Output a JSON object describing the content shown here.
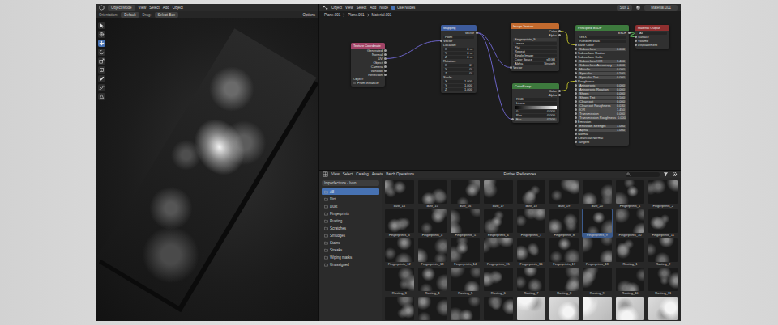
{
  "viewport": {
    "mode": "Object Mode",
    "menus": [
      "View",
      "Select",
      "Add",
      "Object"
    ],
    "orientation_label": "Orientation:",
    "orientation": "Default",
    "drag_label": "Drag:",
    "drag": "Select Box",
    "options": "Options",
    "tools": [
      {
        "kind": "select",
        "selected": false
      },
      {
        "kind": "cursor",
        "selected": false
      },
      {
        "kind": "move",
        "selected": true
      },
      {
        "kind": "rotate",
        "selected": false
      },
      {
        "kind": "scale",
        "selected": false
      },
      {
        "kind": "transform",
        "selected": false
      },
      {
        "kind": "annotate",
        "selected": false
      },
      {
        "kind": "measure",
        "selected": false
      },
      {
        "kind": "add",
        "selected": false
      }
    ]
  },
  "node_editor": {
    "menus": [
      "Object",
      "View",
      "Select",
      "Add",
      "Node"
    ],
    "use_nodes": "Use Nodes",
    "use_nodes_on": true,
    "slot": "Slot 1",
    "material": "Material.001",
    "breadcrumbs": [
      "Plane.001",
      "Plane.001",
      "Material.001"
    ]
  },
  "nodes": [
    {
      "title": "Texture Coordinate",
      "color": "#a14467",
      "rows": [
        {
          "label": "Generated",
          "kind": "out"
        },
        {
          "label": "Normal",
          "kind": "out"
        },
        {
          "label": "UV",
          "kind": "out"
        },
        {
          "label": "Object",
          "kind": "out"
        },
        {
          "label": "Camera",
          "kind": "out"
        },
        {
          "label": "Window",
          "kind": "out"
        },
        {
          "label": "Reflection",
          "kind": "out"
        },
        {
          "label": "Object:",
          "kind": "label"
        },
        {
          "label": "From Instancer",
          "kind": "check",
          "checked": false
        }
      ]
    },
    {
      "title": "Mapping",
      "color": "#3d5b9c",
      "rows": [
        {
          "label": "Vector",
          "kind": "out"
        },
        {
          "label": "Point",
          "kind": "field"
        },
        {
          "label": "Vector",
          "kind": "in"
        },
        {
          "label": "Location:",
          "kind": "label"
        },
        {
          "label": "X",
          "value": "0 m",
          "kind": "field"
        },
        {
          "label": "Y",
          "value": "0 m",
          "kind": "field"
        },
        {
          "label": "Z",
          "value": "0 m",
          "kind": "field"
        },
        {
          "label": "Rotation:",
          "kind": "label"
        },
        {
          "label": "X",
          "value": "0°",
          "kind": "field"
        },
        {
          "label": "Y",
          "value": "0°",
          "kind": "field"
        },
        {
          "label": "Z",
          "value": "0°",
          "kind": "field"
        },
        {
          "label": "Scale:",
          "kind": "label"
        },
        {
          "label": "X",
          "value": "1.000",
          "kind": "field"
        },
        {
          "label": "Y",
          "value": "1.000",
          "kind": "field"
        },
        {
          "label": "Z",
          "value": "1.000",
          "kind": "field"
        }
      ]
    },
    {
      "title": "Image Texture",
      "color": "#c26a2e",
      "rows": [
        {
          "label": "Color",
          "kind": "out"
        },
        {
          "label": "Alpha",
          "kind": "out"
        },
        {
          "label": "Fingerprints_9",
          "kind": "image"
        },
        {
          "label": "Linear",
          "kind": "field"
        },
        {
          "label": "Flat",
          "kind": "field"
        },
        {
          "label": "Repeat",
          "kind": "field"
        },
        {
          "label": "Single Image",
          "kind": "field"
        },
        {
          "label": "Color Space",
          "value": "sRGB",
          "kind": "field"
        },
        {
          "label": "Alpha",
          "value": "Straight",
          "kind": "field"
        },
        {
          "label": "Vector",
          "kind": "in"
        }
      ]
    },
    {
      "title": "ColorRamp",
      "color": "#3d7a3d",
      "rows": [
        {
          "label": "Color",
          "kind": "out"
        },
        {
          "label": "Alpha",
          "kind": "out"
        },
        {
          "label": "RGB",
          "kind": "field"
        },
        {
          "label": "Linear",
          "kind": "field"
        },
        {
          "kind": "ramp"
        },
        {
          "label": "0",
          "value": "0.000",
          "kind": "field"
        },
        {
          "label": "Pos",
          "value": "0.000",
          "kind": "field"
        },
        {
          "label": "Fac",
          "value": "0.500",
          "kind": "in"
        }
      ]
    },
    {
      "title": "Principled BSDF",
      "color": "#3d7a3d",
      "rows": [
        {
          "label": "BSDF",
          "kind": "out"
        },
        {
          "label": "GGX",
          "kind": "field"
        },
        {
          "label": "Random Walk",
          "kind": "field"
        },
        {
          "label": "Base Color",
          "kind": "in"
        },
        {
          "label": "Subsurface",
          "value": "0.000",
          "kind": "in"
        },
        {
          "label": "Subsurface Radius",
          "kind": "in"
        },
        {
          "label": "Subsurface Color",
          "kind": "in"
        },
        {
          "label": "Subsurface IOR",
          "value": "1.400",
          "kind": "in"
        },
        {
          "label": "Subsurface Anisotropy",
          "value": "0.000",
          "kind": "in"
        },
        {
          "label": "Metallic",
          "value": "0.000",
          "kind": "in"
        },
        {
          "label": "Specular",
          "value": "0.500",
          "kind": "in"
        },
        {
          "label": "Specular Tint",
          "value": "0.000",
          "kind": "in"
        },
        {
          "label": "Roughness",
          "kind": "in"
        },
        {
          "label": "Anisotropic",
          "value": "0.000",
          "kind": "in"
        },
        {
          "label": "Anisotropic Rotation",
          "value": "0.000",
          "kind": "in"
        },
        {
          "label": "Sheen",
          "value": "0.000",
          "kind": "in"
        },
        {
          "label": "Sheen Tint",
          "value": "0.500",
          "kind": "in"
        },
        {
          "label": "Clearcoat",
          "value": "0.000",
          "kind": "in"
        },
        {
          "label": "Clearcoat Roughness",
          "value": "0.030",
          "kind": "in"
        },
        {
          "label": "IOR",
          "value": "1.450",
          "kind": "in"
        },
        {
          "label": "Transmission",
          "value": "0.000",
          "kind": "in"
        },
        {
          "label": "Transmission Roughness",
          "value": "0.000",
          "kind": "in"
        },
        {
          "label": "Emission",
          "kind": "in"
        },
        {
          "label": "Emission Strength",
          "value": "1.000",
          "kind": "in"
        },
        {
          "label": "Alpha",
          "value": "1.000",
          "kind": "in"
        },
        {
          "label": "Normal",
          "kind": "in"
        },
        {
          "label": "Clearcoat Normal",
          "kind": "in"
        },
        {
          "label": "Tangent",
          "kind": "in"
        }
      ]
    },
    {
      "title": "Material Output",
      "color": "#8f2f2f",
      "rows": [
        {
          "label": "All",
          "kind": "field"
        },
        {
          "label": "Surface",
          "kind": "in"
        },
        {
          "label": "Volume",
          "kind": "in"
        },
        {
          "label": "Displacement",
          "kind": "in"
        }
      ]
    }
  ],
  "links": [
    {
      "from": 0,
      "out": 2,
      "to": 1,
      "in": 2,
      "color": "#6b63c7"
    },
    {
      "from": 1,
      "out": 0,
      "to": 2,
      "in": 9,
      "color": "#6b63c7"
    },
    {
      "from": 1,
      "out": 0,
      "to": 3,
      "in": 7,
      "color": "#6b63c7"
    },
    {
      "from": 2,
      "out": 0,
      "to": 4,
      "in": 3,
      "color": "#c7c729"
    },
    {
      "from": 3,
      "out": 0,
      "to": 4,
      "in": 12,
      "color": "#c7c729"
    },
    {
      "from": 4,
      "out": 0,
      "to": 5,
      "in": 1,
      "color": "#63c763"
    }
  ],
  "asset_browser": {
    "menus": [
      "View",
      "Select",
      "Catalog",
      "Assets",
      "Batch Operations"
    ],
    "title": "Further Preferences",
    "library": "Imperfections - Ivon",
    "catalogs": [
      {
        "label": "All",
        "selected": true
      },
      {
        "label": "Dirt",
        "selected": false
      },
      {
        "label": "Dust",
        "selected": false
      },
      {
        "label": "Fingerprints",
        "selected": false
      },
      {
        "label": "Rusting",
        "selected": false
      },
      {
        "label": "Scratches",
        "selected": false
      },
      {
        "label": "Smudges",
        "selected": false
      },
      {
        "label": "Stains",
        "selected": false
      },
      {
        "label": "Streaks",
        "selected": false
      },
      {
        "label": "Wiping marks",
        "selected": false
      },
      {
        "label": "Unassigned",
        "selected": false
      }
    ],
    "assets": [
      {
        "name": "dust_14",
        "selected": false,
        "light": false
      },
      {
        "name": "dust_15",
        "selected": false,
        "light": false
      },
      {
        "name": "dust_16",
        "selected": false,
        "light": false
      },
      {
        "name": "dust_17",
        "selected": false,
        "light": false
      },
      {
        "name": "dust_18",
        "selected": false,
        "light": false
      },
      {
        "name": "dust_19",
        "selected": false,
        "light": false
      },
      {
        "name": "dust_20",
        "selected": false,
        "light": false
      },
      {
        "name": "Fingerprints_1",
        "selected": false,
        "light": false
      },
      {
        "name": "Fingerprints_2",
        "selected": false,
        "light": false
      },
      {
        "name": "Fingerprints_3",
        "selected": false,
        "light": false
      },
      {
        "name": "Fingerprints_4",
        "selected": false,
        "light": false
      },
      {
        "name": "Fingerprints_5",
        "selected": false,
        "light": false
      },
      {
        "name": "Fingerprints_6",
        "selected": false,
        "light": false
      },
      {
        "name": "Fingerprints_7",
        "selected": false,
        "light": false
      },
      {
        "name": "Fingerprints_8",
        "selected": false,
        "light": false
      },
      {
        "name": "Fingerprints_9",
        "selected": true,
        "light": false
      },
      {
        "name": "Fingerprints_10",
        "selected": false,
        "light": false
      },
      {
        "name": "Fingerprints_11",
        "selected": false,
        "light": false
      },
      {
        "name": "Fingerprints_12",
        "selected": false,
        "light": false
      },
      {
        "name": "Fingerprints_13",
        "selected": false,
        "light": false
      },
      {
        "name": "Fingerprints_14",
        "selected": false,
        "light": false
      },
      {
        "name": "Fingerprints_15",
        "selected": false,
        "light": false
      },
      {
        "name": "Fingerprints_16",
        "selected": false,
        "light": false
      },
      {
        "name": "Fingerprints_17",
        "selected": false,
        "light": false
      },
      {
        "name": "Fingerprints_18",
        "selected": false,
        "light": false
      },
      {
        "name": "Rusting_1",
        "selected": false,
        "light": false
      },
      {
        "name": "Rusting_2",
        "selected": false,
        "light": false
      },
      {
        "name": "Rusting_3",
        "selected": false,
        "light": false
      },
      {
        "name": "Rusting_4",
        "selected": false,
        "light": false
      },
      {
        "name": "Rusting_5",
        "selected": false,
        "light": false
      },
      {
        "name": "Rusting_6",
        "selected": false,
        "light": false
      },
      {
        "name": "Rusting_7",
        "selected": false,
        "light": false
      },
      {
        "name": "Rusting_8",
        "selected": false,
        "light": false
      },
      {
        "name": "Rusting_9",
        "selected": false,
        "light": false
      },
      {
        "name": "Rusting_10",
        "selected": false,
        "light": false
      },
      {
        "name": "Rusting_11",
        "selected": false,
        "light": false
      }
    ],
    "partial_thumbs": [
      {
        "light": false
      },
      {
        "light": false
      },
      {
        "light": false
      },
      {
        "light": false
      },
      {
        "light": true
      },
      {
        "light": true
      },
      {
        "light": true
      },
      {
        "light": true
      },
      {
        "light": true
      }
    ]
  }
}
